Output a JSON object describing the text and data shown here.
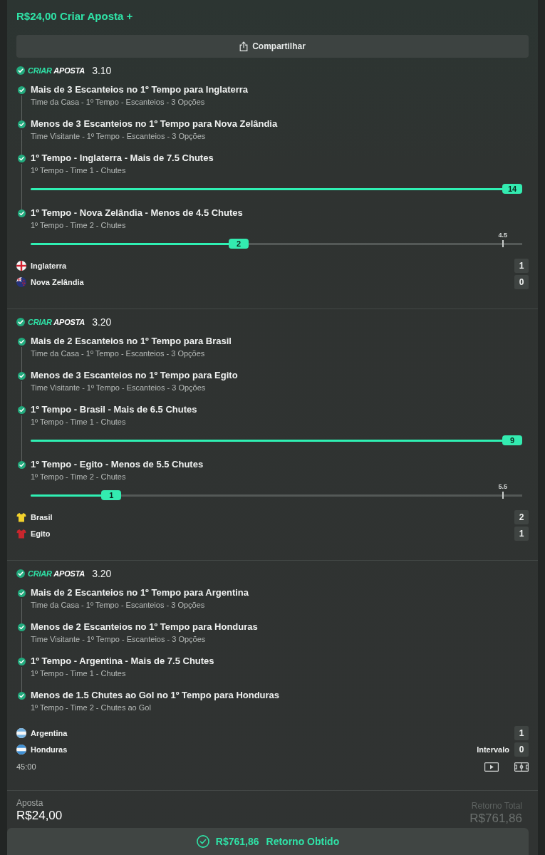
{
  "header": {
    "title": "R$24,00 Criar Aposta +"
  },
  "share_button": {
    "label": "Compartilhar"
  },
  "sections": [
    {
      "won": true,
      "logo": {
        "accent": "CRIAR",
        "text": "APOSTA"
      },
      "odds": "3.10",
      "selections": [
        {
          "won": true,
          "title": "Mais de 3 Escanteios no 1º Tempo para Inglaterra",
          "details": "Time da Casa - 1º Tempo - Escanteios - 3 Opções"
        },
        {
          "won": true,
          "title": "Menos de 3 Escanteios no 1º Tempo para Nova Zelândia",
          "details": "Time Visitante - 1º Tempo - Escanteios - 3 Opções"
        },
        {
          "won": true,
          "title": "1º Tempo - Inglaterra - Mais de 7.5 Chutes",
          "details": "1º Tempo - Time 1 - Chutes",
          "progress": {
            "value": "14",
            "level": 1
          }
        },
        {
          "won": true,
          "title": "1º Tempo - Nova Zelândia - Menos de 4.5 Chutes",
          "details": "1º Tempo - Time 2 - Chutes",
          "progress": {
            "value": "2",
            "level": 0.42,
            "threshold": {
              "label": "4.5",
              "level": 0.98
            }
          }
        }
      ],
      "teams": [
        {
          "name": "Inglaterra",
          "score": "1",
          "kind": "cross"
        },
        {
          "name": "Nova Zelândia",
          "score": "0",
          "kind": "ensign"
        }
      ]
    },
    {
      "won": true,
      "logo": {
        "accent": "CRIAR",
        "text": "APOSTA"
      },
      "odds": "3.20",
      "selections": [
        {
          "won": true,
          "title": "Mais de 2 Escanteios no 1º Tempo para Brasil",
          "details": "Time da Casa - 1º Tempo - Escanteios - 3 Opções"
        },
        {
          "won": true,
          "title": "Menos de 3 Escanteios no 1º Tempo para Egito",
          "details": "Time Visitante - 1º Tempo - Escanteios - 3 Opções"
        },
        {
          "won": true,
          "title": "1º Tempo - Brasil - Mais de 6.5 Chutes",
          "details": "1º Tempo - Time 1 - Chutes",
          "progress": {
            "value": "9",
            "level": 1
          }
        },
        {
          "won": true,
          "title": "1º Tempo - Egito - Menos de 5.5 Chutes",
          "details": "1º Tempo - Time 2 - Chutes",
          "progress": {
            "value": "1",
            "level": 0.15,
            "threshold": {
              "label": "5.5",
              "level": 0.98
            }
          }
        }
      ],
      "teams": [
        {
          "name": "Brasil",
          "score": "2",
          "kind": "shirt",
          "color": "#f2d12c"
        },
        {
          "name": "Egito",
          "score": "1",
          "kind": "shirt",
          "color": "#c8262d"
        }
      ]
    },
    {
      "won": true,
      "logo": {
        "accent": "CRIAR",
        "text": "APOSTA"
      },
      "odds": "3.20",
      "selections": [
        {
          "won": true,
          "title": "Mais de 2 Escanteios no 1º Tempo para Argentina",
          "details": "Time da Casa - 1º Tempo - Escanteios - 3 Opções"
        },
        {
          "won": true,
          "title": "Menos de 2 Escanteios no 1º Tempo para Honduras",
          "details": "Time Visitante - 1º Tempo - Escanteios - 3 Opções"
        },
        {
          "won": true,
          "title": "1º Tempo - Argentina - Mais de 7.5 Chutes",
          "details": "1º Tempo - Time 1 - Chutes"
        },
        {
          "won": true,
          "title": "Menos de 1.5 Chutes ao Gol no 1º Tempo para Honduras",
          "details": "1º Tempo - Time 2 - Chutes ao Gol"
        }
      ],
      "teams": [
        {
          "name": "Argentina",
          "score": "1",
          "kind": "stripes",
          "color": "#75b2e0"
        },
        {
          "name": "Honduras",
          "score": "0",
          "kind": "stripes",
          "color": "#3f8fd2",
          "status": "Intervalo"
        }
      ],
      "time": "45:00"
    }
  ],
  "footer": {
    "stake": {
      "label": "Aposta",
      "value": "R$24,00"
    },
    "total_return": {
      "label": "Retorno Total",
      "value": "R$761,86"
    }
  },
  "return_bar": {
    "amount": "R$761,86",
    "label": "Retorno Obtido"
  }
}
